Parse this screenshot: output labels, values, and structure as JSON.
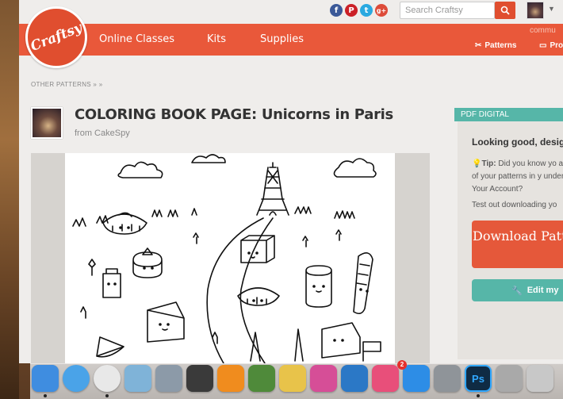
{
  "topbar": {
    "search_placeholder": "Search Craftsy",
    "social": [
      {
        "name": "facebook-icon",
        "glyph": "f",
        "color": "#3b5998"
      },
      {
        "name": "pinterest-icon",
        "glyph": "P",
        "color": "#cb2027"
      },
      {
        "name": "twitter-icon",
        "glyph": "t",
        "color": "#2aa9e0"
      },
      {
        "name": "googleplus-icon",
        "glyph": "g+",
        "color": "#dd4b39"
      }
    ]
  },
  "nav": {
    "logo": "Craftsy",
    "items": [
      "Online Classes",
      "Kits",
      "Supplies"
    ],
    "right_top": "commu",
    "patterns": "Patterns",
    "projects": "Pro"
  },
  "breadcrumb": "OTHER PATTERNS  »   »",
  "pattern": {
    "title": "COLORING BOOK PAGE: Unicorns in Paris",
    "from": "from CakeSpy"
  },
  "sidebar": {
    "tab": "PDF DIGITAL DOWNLOAD",
    "heading": "Looking good, desig",
    "tip_label": "Tip:",
    "tip_text": " Did you know yo all of your patterns in y under Your Account?",
    "test_text": "Test out downloading yo",
    "download_label": "Download Patte",
    "edit_label": "Edit my"
  },
  "dock": {
    "badge": "2",
    "icons": [
      {
        "name": "finder-icon",
        "color": "#3f8de0",
        "glyph": ""
      },
      {
        "name": "safari-icon",
        "color": "#4aa3e8",
        "glyph": ""
      },
      {
        "name": "chrome-icon",
        "color": "#e8e8e8",
        "glyph": ""
      },
      {
        "name": "preview-icon",
        "color": "#7fb3d8",
        "glyph": ""
      },
      {
        "name": "image-capture-icon",
        "color": "#8c9aa8",
        "glyph": ""
      },
      {
        "name": "facetime-icon",
        "color": "#3a3a3a",
        "glyph": ""
      },
      {
        "name": "ibooks-icon",
        "color": "#f08c1e",
        "glyph": ""
      },
      {
        "name": "photo-booth-icon",
        "color": "#4f8a3a",
        "glyph": ""
      },
      {
        "name": "stickies-icon",
        "color": "#e8c34a",
        "glyph": ""
      },
      {
        "name": "numbers-icon",
        "color": "#d64e97",
        "glyph": ""
      },
      {
        "name": "keynote-icon",
        "color": "#2b78c6",
        "glyph": ""
      },
      {
        "name": "itunes-icon",
        "color": "#e84f7a",
        "glyph": ""
      },
      {
        "name": "app-store-icon",
        "color": "#2d8de6",
        "glyph": ""
      },
      {
        "name": "system-preferences-icon",
        "color": "#8f9499",
        "glyph": ""
      },
      {
        "name": "photoshop-icon",
        "color": "#0f2b44",
        "glyph": "Ps"
      },
      {
        "name": "automator-icon",
        "color": "#a9a9a9",
        "glyph": ""
      },
      {
        "name": "downloads-stack-icon",
        "color": "#c8c8c8",
        "glyph": ""
      }
    ]
  }
}
